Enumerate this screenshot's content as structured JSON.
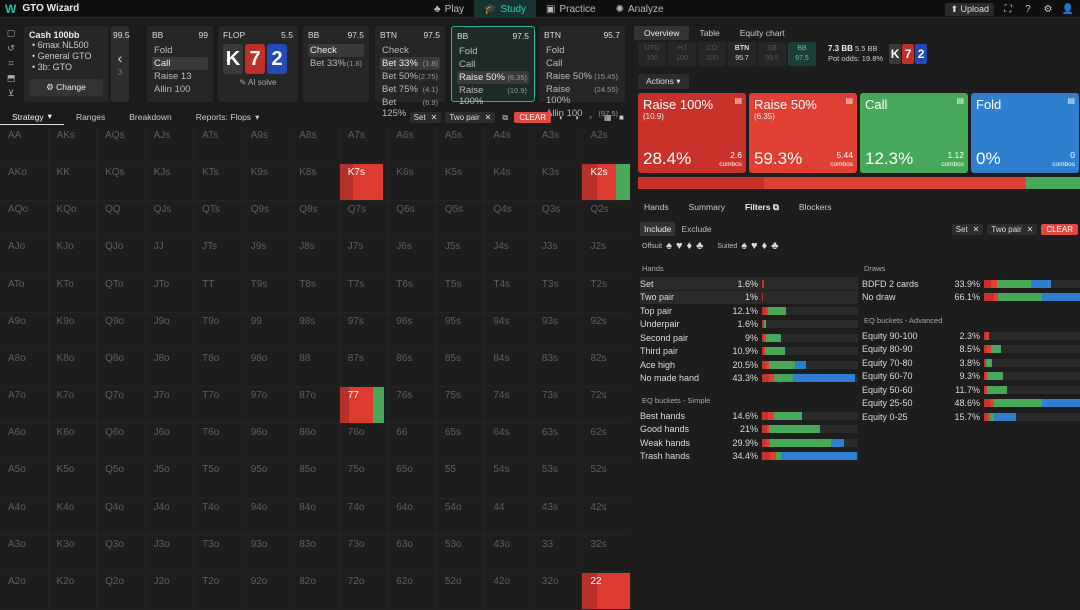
{
  "app": {
    "title": "GTO Wizard",
    "logo": "W"
  },
  "nav": [
    {
      "label": "Play",
      "icon": "♣",
      "active": false
    },
    {
      "label": "Study",
      "icon": "🎓",
      "active": true
    },
    {
      "label": "Practice",
      "icon": "▣",
      "active": false
    },
    {
      "label": "Analyze",
      "icon": "✺",
      "active": false
    }
  ],
  "top_right": {
    "upload": "⬆ Upload",
    "icons": [
      "⛶",
      "?",
      "⚙",
      "👤"
    ]
  },
  "left_rail": [
    "▢",
    "↺",
    "⌗",
    "⬒",
    "⊻"
  ],
  "cash": {
    "title": "Cash 100bb",
    "items": [
      "6max NL500",
      "General GTO",
      "3b: GTO"
    ],
    "change": "Change",
    "change_icon": "⚙"
  },
  "panels": [
    {
      "pos": "",
      "stack": "99.5",
      "dim": true,
      "lines": [],
      "back": "‹",
      "extra": "3"
    },
    {
      "pos": "BB",
      "stack": "99",
      "lines": [
        {
          "t": "Fold"
        },
        {
          "t": "Call",
          "sel": true
        },
        {
          "t": "Raise 13"
        },
        {
          "t": "Allin 100"
        }
      ]
    },
    {
      "pos": "FLOP",
      "stack": "5.5",
      "cards": [
        {
          "r": "K",
          "c": "#3a3a3b"
        },
        {
          "r": "7",
          "c": "#c0302a"
        },
        {
          "r": "2",
          "c": "#2449b8"
        }
      ],
      "aisolve": "✎ AI solve"
    },
    {
      "pos": "BB",
      "stack": "97.5",
      "lines": [
        {
          "t": "Check",
          "sel": true
        },
        {
          "t": "Bet 33%",
          "s": "(1.8)"
        }
      ]
    },
    {
      "pos": "BTN",
      "stack": "97.5",
      "lines": [
        {
          "t": "Check"
        },
        {
          "t": "Bet 33%",
          "s": "(1.8)",
          "sel": true
        },
        {
          "t": "Bet 50%",
          "s": "(2.75)"
        },
        {
          "t": "Bet 75%",
          "s": "(4.1)"
        },
        {
          "t": "Bet 125%",
          "s": "(6.9)"
        }
      ]
    },
    {
      "pos": "BB",
      "stack": "97.5",
      "active": true,
      "lines": [
        {
          "t": "Fold"
        },
        {
          "t": "Call"
        },
        {
          "t": "Raise 50%",
          "s": "(6.35)",
          "sel": true
        },
        {
          "t": "Raise 100%",
          "s": "(10.9)"
        }
      ]
    },
    {
      "pos": "BTN",
      "stack": "95.7",
      "lines": [
        {
          "t": "Fold"
        },
        {
          "t": "Call"
        },
        {
          "t": "Raise 50%",
          "s": "(15.45)"
        },
        {
          "t": "Raise 100%",
          "s": "(24.55)"
        },
        {
          "t": "Allin 100",
          "s": "(97.5)"
        }
      ]
    }
  ],
  "toolbar": {
    "tabs": [
      "Strategy",
      "Ranges",
      "Breakdown",
      "Reports: Flops"
    ],
    "dropdown_marks": [
      "▾",
      "",
      "",
      "▾"
    ],
    "chips": [
      "Set",
      "Two pair"
    ],
    "clear": "CLEAR",
    "chip_x": "✕",
    "icons": [
      "⧉",
      "◐",
      "◑",
      "▫",
      "▦",
      "■"
    ]
  },
  "grid": {
    "labels": [
      [
        "AA",
        "AKs",
        "AQs",
        "AJs",
        "ATs",
        "A9s",
        "A8s",
        "A7s",
        "A6s",
        "A5s",
        "A4s",
        "A3s",
        "A2s"
      ],
      [
        "AKo",
        "KK",
        "KQs",
        "KJs",
        "KTs",
        "K9s",
        "K8s",
        "K7s",
        "K6s",
        "K5s",
        "K4s",
        "K3s",
        "K2s"
      ],
      [
        "AQo",
        "KQo",
        "QQ",
        "QJs",
        "QTs",
        "Q9s",
        "Q8s",
        "Q7s",
        "Q6s",
        "Q5s",
        "Q4s",
        "Q3s",
        "Q2s"
      ],
      [
        "AJo",
        "KJo",
        "QJo",
        "JJ",
        "JTs",
        "J9s",
        "J8s",
        "J7s",
        "J6s",
        "J5s",
        "J4s",
        "J3s",
        "J2s"
      ],
      [
        "ATo",
        "KTo",
        "QTo",
        "JTo",
        "TT",
        "T9s",
        "T8s",
        "T7s",
        "T6s",
        "T5s",
        "T4s",
        "T3s",
        "T2s"
      ],
      [
        "A9o",
        "K9o",
        "Q9o",
        "J9o",
        "T9o",
        "99",
        "98s",
        "97s",
        "96s",
        "95s",
        "94s",
        "93s",
        "92s"
      ],
      [
        "A8o",
        "K8o",
        "Q8o",
        "J8o",
        "T8o",
        "98o",
        "88",
        "87s",
        "86s",
        "85s",
        "84s",
        "83s",
        "82s"
      ],
      [
        "A7o",
        "K7o",
        "Q7o",
        "J7o",
        "T7o",
        "97o",
        "87o",
        "77",
        "76s",
        "75s",
        "74s",
        "73s",
        "72s"
      ],
      [
        "A6o",
        "K6o",
        "Q6o",
        "J6o",
        "T6o",
        "96o",
        "86o",
        "76o",
        "66",
        "65s",
        "64s",
        "63s",
        "62s"
      ],
      [
        "A5o",
        "K5o",
        "Q5o",
        "J5o",
        "T5o",
        "95o",
        "85o",
        "75o",
        "65o",
        "55",
        "54s",
        "53s",
        "52s"
      ],
      [
        "A4o",
        "K4o",
        "Q4o",
        "J4o",
        "T4o",
        "94o",
        "84o",
        "74o",
        "64o",
        "54o",
        "44",
        "43s",
        "42s"
      ],
      [
        "A3o",
        "K3o",
        "Q3o",
        "J3o",
        "T3o",
        "93o",
        "83o",
        "73o",
        "63o",
        "53o",
        "43o",
        "33",
        "32s"
      ],
      [
        "A2o",
        "K2o",
        "Q2o",
        "J2o",
        "T2o",
        "92o",
        "82o",
        "72o",
        "62o",
        "52o",
        "42o",
        "32o",
        "22"
      ]
    ],
    "highlights": [
      {
        "hand": "K7s",
        "segments": [
          {
            "c": "#b8302a",
            "f": 0.3
          },
          {
            "c": "#dd3b30",
            "f": 0.7
          }
        ],
        "fill": 0.92
      },
      {
        "hand": "K2s",
        "segments": [
          {
            "c": "#b8302a",
            "f": 0.3
          },
          {
            "c": "#dd3b30",
            "f": 0.4
          },
          {
            "c": "#4aa85a",
            "f": 0.3
          }
        ],
        "fill": 1
      },
      {
        "hand": "77",
        "segments": [
          {
            "c": "#b8302a",
            "f": 0.2
          },
          {
            "c": "#dd3b30",
            "f": 0.55
          },
          {
            "c": "#4aa85a",
            "f": 0.25
          }
        ],
        "fill": 0.92
      },
      {
        "hand": "22",
        "segments": [
          {
            "c": "#b8302a",
            "f": 0.3
          },
          {
            "c": "#dd3b30",
            "f": 0.7
          }
        ],
        "fill": 1
      }
    ]
  },
  "right": {
    "tabs": [
      "Overview",
      "Table",
      "Equity chart"
    ],
    "positions": [
      {
        "n": "UTG",
        "s": "100",
        "state": "off"
      },
      {
        "n": "HJ",
        "s": "100",
        "state": "off"
      },
      {
        "n": "CO",
        "s": "100",
        "state": "off"
      },
      {
        "n": "BTN",
        "s": "95.7",
        "state": "on"
      },
      {
        "n": "SB",
        "s": "99.5",
        "state": "off"
      },
      {
        "n": "BB",
        "s": "97.5",
        "state": "cur"
      }
    ],
    "pot": {
      "main": "7.3 BB",
      "side": "5.5 BB",
      "odds_label": "Pot odds:",
      "odds": "19.8%"
    },
    "board": [
      {
        "r": "K",
        "c": "#3a3a3b"
      },
      {
        "r": "7",
        "c": "#c0302a"
      },
      {
        "r": "2",
        "c": "#2449b8"
      }
    ],
    "actions_label": "Actions ▾",
    "actions": [
      {
        "name": "Raise 100%",
        "size": "(10.9)",
        "pct": "28.4%",
        "combos": "2.6",
        "color": "#c9322b",
        "freq": 0.284
      },
      {
        "name": "Raise 50%",
        "size": "(6.35)",
        "pct": "59.3%",
        "combos": "5.44",
        "color": "#e03f33",
        "freq": 0.593
      },
      {
        "name": "Call",
        "size": "",
        "pct": "12.3%",
        "combos": "1.12",
        "color": "#47a85a",
        "freq": 0.123
      },
      {
        "name": "Fold",
        "size": "",
        "pct": "0%",
        "combos": "0",
        "color": "#2f7fd0",
        "freq": 0
      }
    ],
    "combos_word": "combos",
    "subtabs": [
      "Hands",
      "Summary",
      "Filters ⧉",
      "Blockers"
    ],
    "filter": {
      "include": "Include",
      "exclude": "Exclude",
      "chips": [
        "Set",
        "Two pair"
      ],
      "clear": "CLEAR"
    },
    "suits": {
      "offsuit": "Offsuit",
      "suited": "Suited",
      "symbols": [
        "♠",
        "♥",
        "♦",
        "♣"
      ]
    },
    "hands_title": "Hands",
    "hands": [
      {
        "n": "Set",
        "p": "1.6%",
        "w": 0.016,
        "seg": [
          1,
          0,
          0,
          0
        ],
        "shade": true
      },
      {
        "n": "Two pair",
        "p": "1%",
        "w": 0.01,
        "seg": [
          1,
          0,
          0,
          0
        ],
        "shade": true
      },
      {
        "n": "Top pair",
        "p": "12.1%",
        "w": 0.25,
        "seg": [
          0.15,
          0.1,
          0.75,
          0
        ]
      },
      {
        "n": "Underpair",
        "p": "1.6%",
        "w": 0.04,
        "seg": [
          0.5,
          0,
          0.5,
          0
        ]
      },
      {
        "n": "Second pair",
        "p": "9%",
        "w": 0.2,
        "seg": [
          0.1,
          0.1,
          0.8,
          0
        ]
      },
      {
        "n": "Third pair",
        "p": "10.9%",
        "w": 0.24,
        "seg": [
          0.1,
          0.05,
          0.85,
          0
        ]
      },
      {
        "n": "Ace high",
        "p": "20.5%",
        "w": 0.46,
        "seg": [
          0.1,
          0.05,
          0.6,
          0.25
        ]
      },
      {
        "n": "No made hand",
        "p": "43.3%",
        "w": 0.97,
        "seg": [
          0.08,
          0.05,
          0.2,
          0.67
        ]
      }
    ],
    "eq_simple_title": "EQ buckets - Simple",
    "eq_simple": [
      {
        "n": "Best hands",
        "p": "14.6%",
        "w": 0.42,
        "seg": [
          0.15,
          0.15,
          0.7,
          0
        ]
      },
      {
        "n": "Good hands",
        "p": "21%",
        "w": 0.6,
        "seg": [
          0.08,
          0.05,
          0.87,
          0
        ]
      },
      {
        "n": "Weak hands",
        "p": "29.9%",
        "w": 0.85,
        "seg": [
          0.05,
          0.05,
          0.75,
          0.15
        ]
      },
      {
        "n": "Trash hands",
        "p": "34.4%",
        "w": 0.99,
        "seg": [
          0.08,
          0.07,
          0.05,
          0.8
        ]
      }
    ],
    "draws_title": "Draws",
    "draws": [
      {
        "n": "BDFD 2 cards",
        "p": "33.9%",
        "w": 0.7,
        "seg": [
          0.1,
          0.1,
          0.5,
          0.3
        ]
      },
      {
        "n": "No draw",
        "p": "66.1%",
        "w": 1,
        "seg": [
          0.1,
          0.05,
          0.45,
          0.4
        ]
      }
    ],
    "eq_adv_title": "EQ buckets - Advanced",
    "eq_adv": [
      {
        "n": "Equity 90-100",
        "p": "2.3%",
        "w": 0.05,
        "seg": [
          0.5,
          0.5,
          0,
          0
        ]
      },
      {
        "n": "Equity 80-90",
        "p": "8.5%",
        "w": 0.18,
        "seg": [
          0.2,
          0.2,
          0.6,
          0
        ]
      },
      {
        "n": "Equity 70-80",
        "p": "3.8%",
        "w": 0.08,
        "seg": [
          0.2,
          0,
          0.8,
          0
        ]
      },
      {
        "n": "Equity 60-70",
        "p": "9.3%",
        "w": 0.2,
        "seg": [
          0.1,
          0.05,
          0.85,
          0
        ]
      },
      {
        "n": "Equity 50-60",
        "p": "11.7%",
        "w": 0.24,
        "seg": [
          0.1,
          0.05,
          0.85,
          0
        ]
      },
      {
        "n": "Equity 25-50",
        "p": "48.6%",
        "w": 1,
        "seg": [
          0.06,
          0.04,
          0.5,
          0.4
        ]
      },
      {
        "n": "Equity 0-25",
        "p": "15.7%",
        "w": 0.33,
        "seg": [
          0.1,
          0.1,
          0.1,
          0.7
        ]
      }
    ],
    "bar_colors": [
      "#c9322b",
      "#e03f33",
      "#47a85a",
      "#2f7fd0"
    ]
  }
}
